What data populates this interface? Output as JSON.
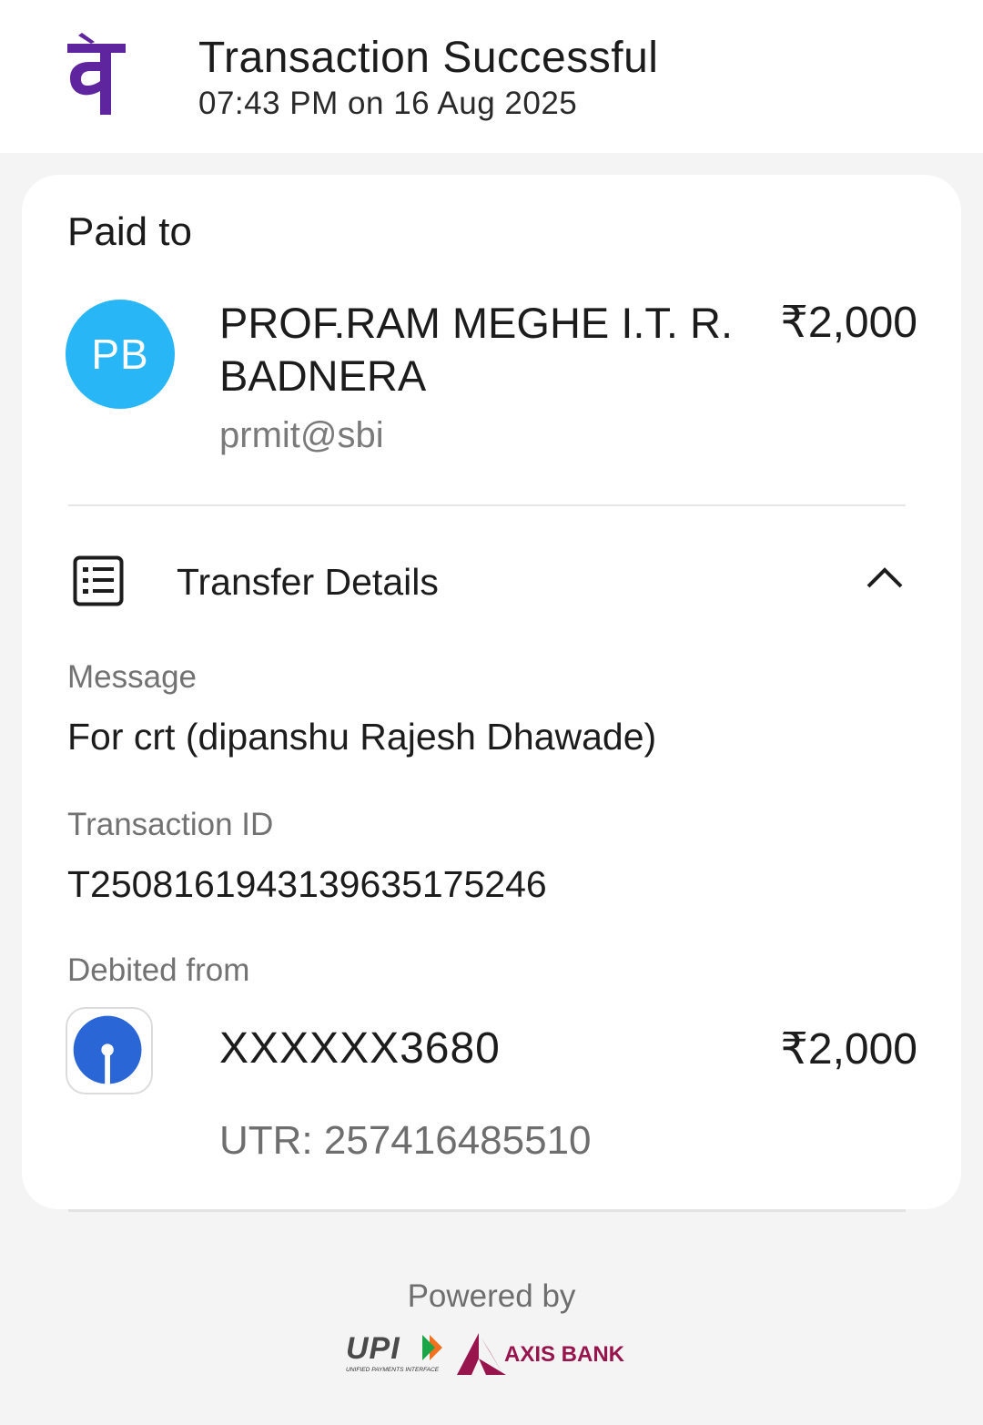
{
  "header": {
    "title": "Transaction Successful",
    "timestamp": "07:43 PM on 16 Aug 2025",
    "logo_icon": "phonepe-logo-icon",
    "brand_color": "#5f259f"
  },
  "payee": {
    "section_label": "Paid to",
    "avatar_initials": "PB",
    "avatar_color": "#29b6f6",
    "name": "PROF.RAM MEGHE I.T. R. BADNERA",
    "amount": "₹2,000",
    "vpa": "prmit@sbi"
  },
  "transfer_details": {
    "title": "Transfer Details",
    "icon": "list-details-icon",
    "toggle_icon": "chevron-up-icon",
    "message_label": "Message",
    "message_value": "For crt (dipanshu Rajesh Dhawade)",
    "transaction_id_label": "Transaction ID",
    "transaction_id_value": "T2508161943139635175246",
    "debited_from_label": "Debited from",
    "account_number": "XXXXXX3680",
    "debit_amount": "₹2,000",
    "utr": "UTR: 257416485510",
    "bank_icon": "sbi-logo-icon"
  },
  "footer": {
    "powered_by": "Powered by",
    "upi_text": "UPI",
    "upi_subtext": "UNIFIED PAYMENTS INTERFACE",
    "axis_text": "AXIS BANK",
    "axis_color": "#97144d"
  }
}
